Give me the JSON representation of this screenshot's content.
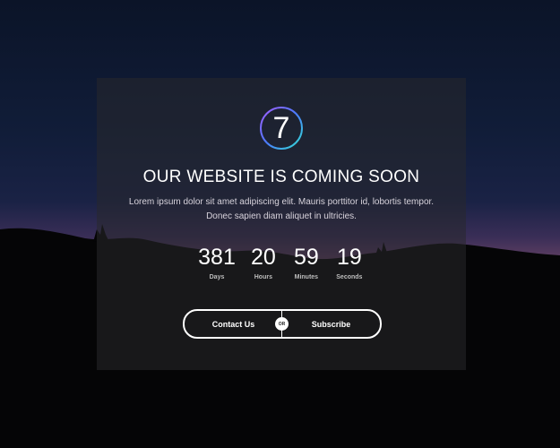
{
  "logo": {
    "number": "7",
    "icon": "circle-gradient-ring"
  },
  "title": "OUR WEBSITE IS COMING SOON",
  "description": "Lorem ipsum dolor sit amet adipiscing elit. Mauris porttitor id, lobortis tempor. Donec sapien diam aliquet in ultricies.",
  "countdown": [
    {
      "value": "381",
      "label": "Days"
    },
    {
      "value": "20",
      "label": "Hours"
    },
    {
      "value": "59",
      "label": "Minutes"
    },
    {
      "value": "19",
      "label": "Seconds"
    }
  ],
  "buttons": {
    "contact_label": "Contact Us",
    "or_label": "OR",
    "subscribe_label": "Subscribe"
  },
  "colors": {
    "ring_start": "#4b7bff",
    "ring_end": "#32e0d0",
    "ring_mid": "#a55cff"
  }
}
